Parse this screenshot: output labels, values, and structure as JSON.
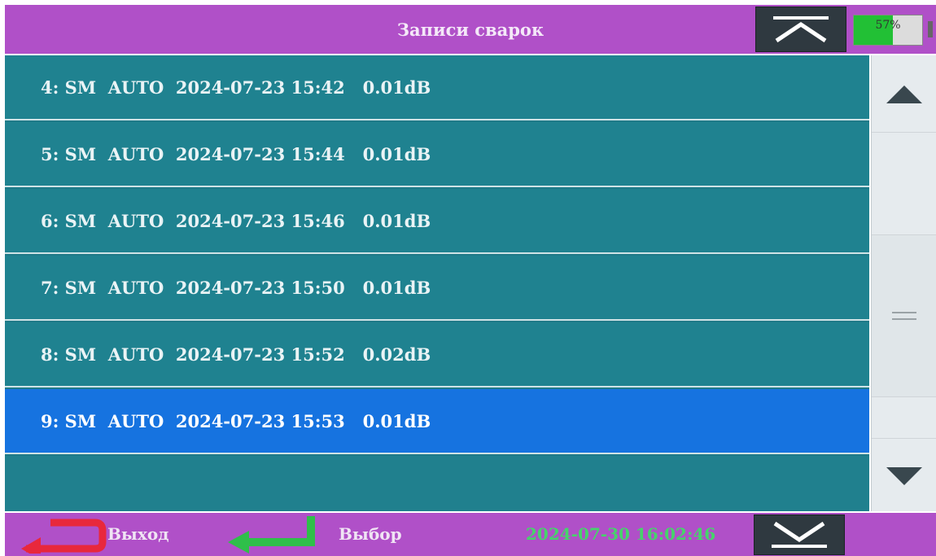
{
  "header": {
    "title": "Записи сварок"
  },
  "battery": {
    "text": "57%",
    "level": 0.57
  },
  "records": [
    {
      "text": "4: SM  AUTO  2024-07-23 15:42   0.01dB",
      "selected": false
    },
    {
      "text": "5: SM  AUTO  2024-07-23 15:44   0.01dB",
      "selected": false
    },
    {
      "text": "6: SM  AUTO  2024-07-23 15:46   0.01dB",
      "selected": false
    },
    {
      "text": "7: SM  AUTO  2024-07-23 15:50   0.01dB",
      "selected": false
    },
    {
      "text": "8: SM  AUTO  2024-07-23 15:52   0.02dB",
      "selected": false
    },
    {
      "text": "9: SM  AUTO  2024-07-23 15:53   0.01dB",
      "selected": true
    }
  ],
  "footer": {
    "exit_label": "Выход",
    "select_label": "Выбор",
    "datetime": "2024-07-30 16:02:46"
  },
  "colors": {
    "header_bg": "#b050c8",
    "row_bg": "#1f8290",
    "selected_bg": "#1673e0",
    "datetime_green": "#46d36b",
    "exit_icon_red": "#e8283c",
    "enter_icon_green": "#2fbf4a"
  },
  "icons": {
    "top_button": "chevron-up-bar-icon",
    "bottom_button": "chevron-down-bar-icon",
    "exit": "return-arrow-icon",
    "select": "enter-arrow-icon",
    "scroll_up": "triangle-up-icon",
    "scroll_down": "triangle-down-icon"
  }
}
